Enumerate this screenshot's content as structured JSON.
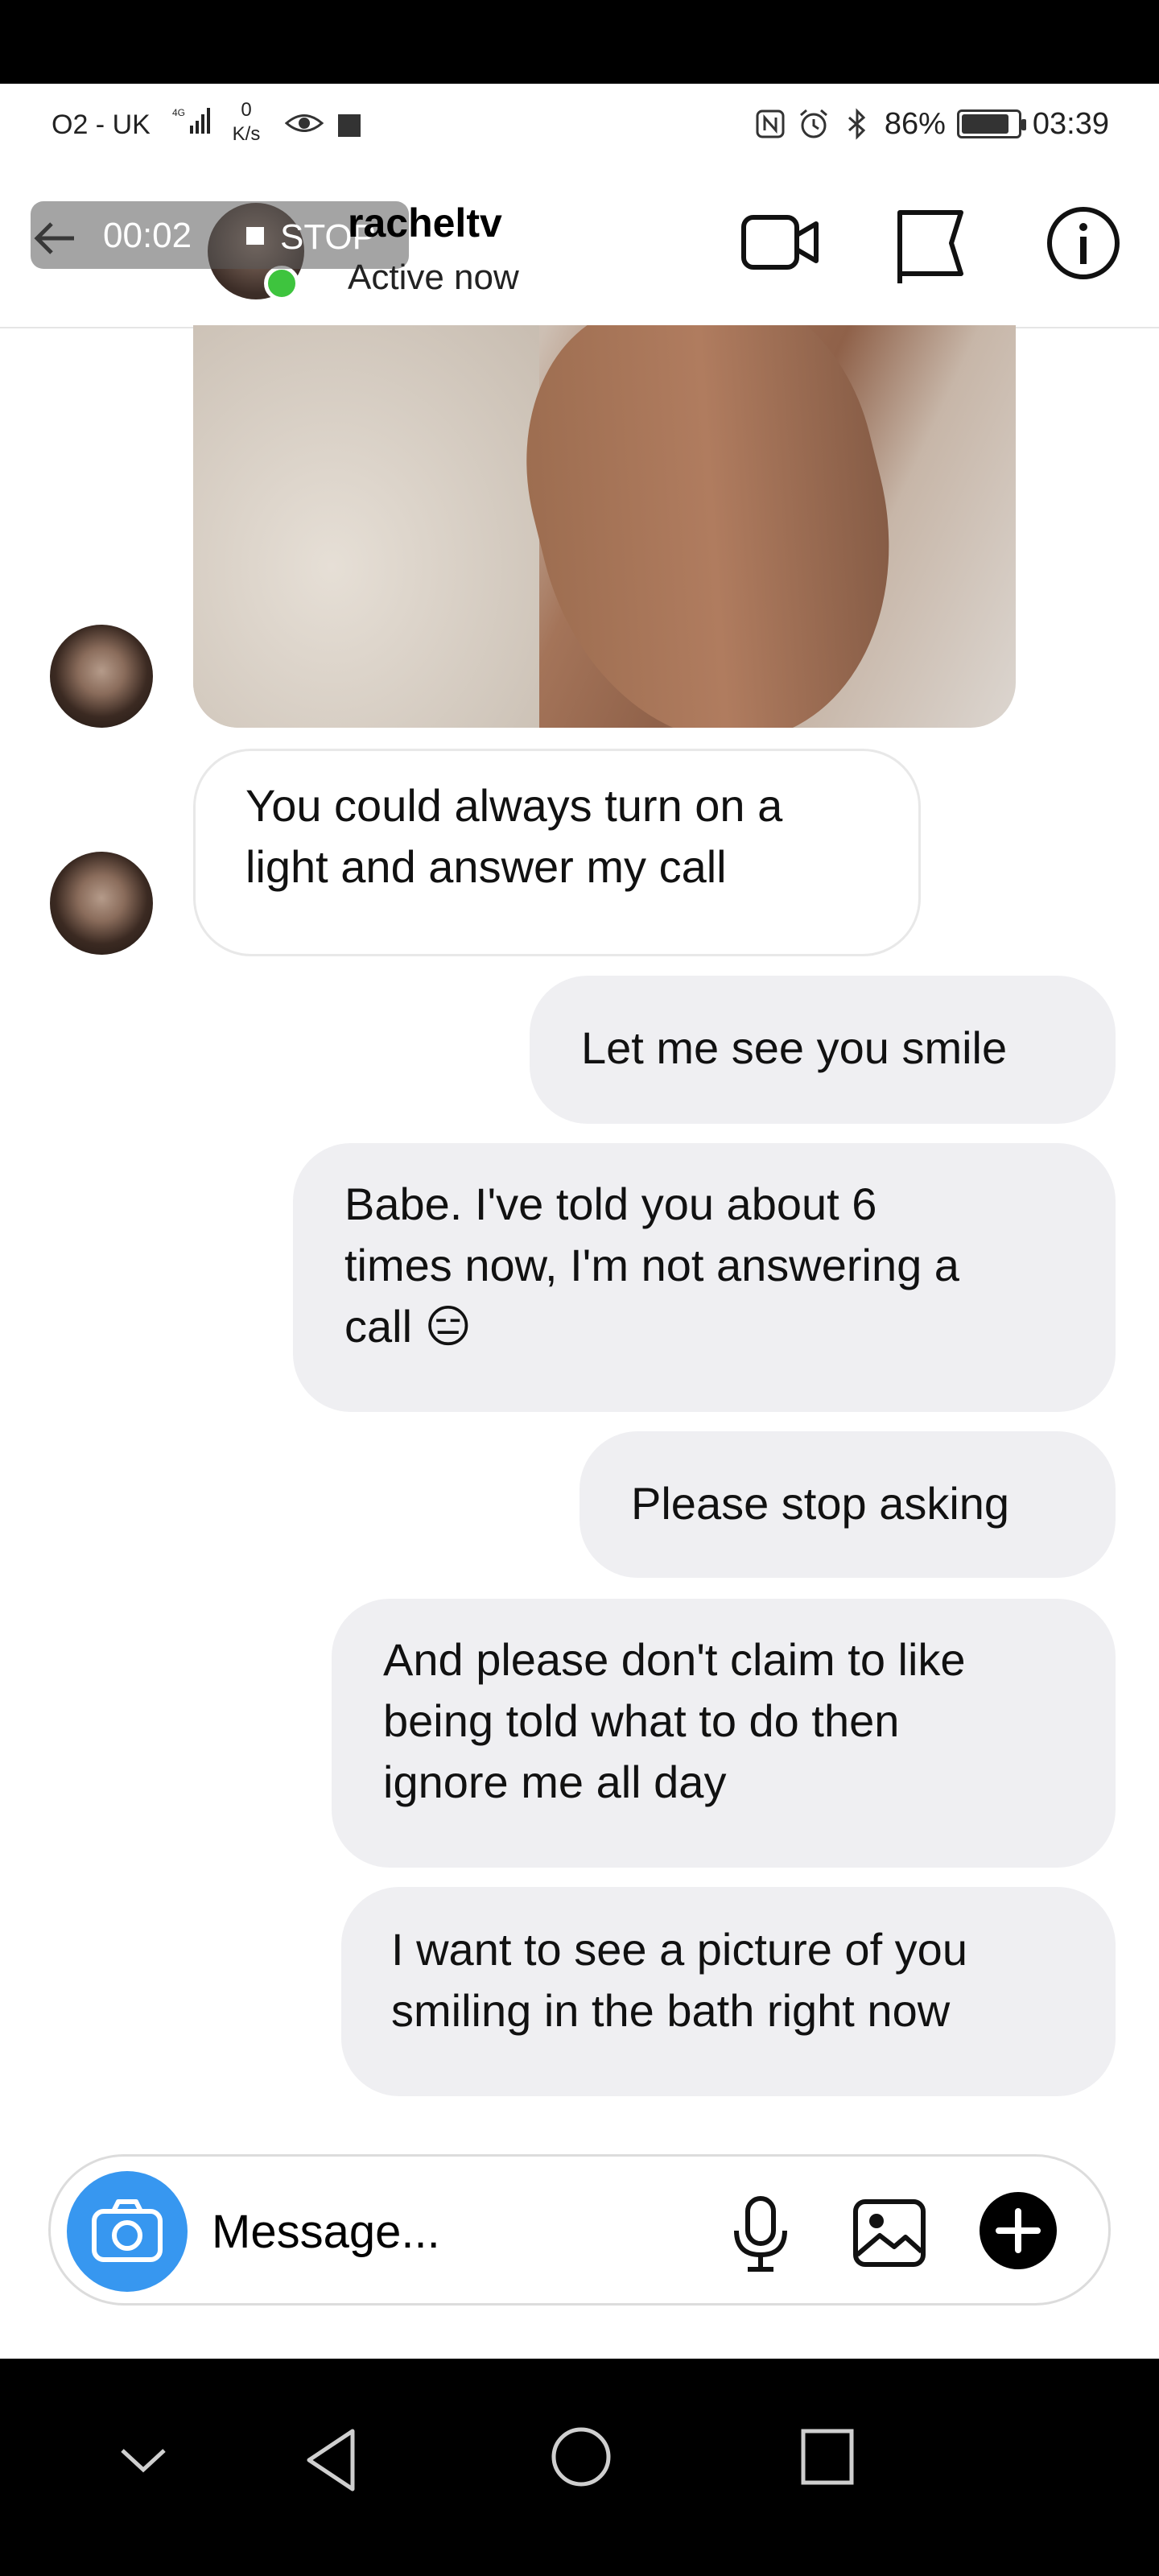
{
  "status_bar": {
    "carrier": "O2 - UK",
    "network": "4G",
    "speed_value": "0",
    "speed_unit": "K/s",
    "battery": "86%",
    "battery_level": 0.86,
    "time": "03:39"
  },
  "recording": {
    "time": "00:02",
    "stop_label": "STOP"
  },
  "header": {
    "username": "racheltv",
    "status": "Active now"
  },
  "messages": [
    {
      "from": "them",
      "lines": [
        "You could always turn on a",
        "light and answer my call"
      ]
    },
    {
      "from": "me",
      "lines": [
        "Let me see you smile"
      ]
    },
    {
      "from": "me",
      "lines": [
        "Babe. I've told you about 6",
        "times now, I'm not answering a",
        "call 😑"
      ]
    },
    {
      "from": "me",
      "lines": [
        "Please stop asking"
      ]
    },
    {
      "from": "me",
      "lines": [
        "And please don't claim to like",
        "being told what to do then",
        "ignore me all day"
      ]
    },
    {
      "from": "me",
      "lines": [
        "I want to see a picture of you",
        "smiling in the bath right now"
      ]
    }
  ],
  "composer": {
    "placeholder": "Message..."
  },
  "colors": {
    "accent": "#3797f0",
    "online": "#3ec43e",
    "bubble_out": "#efeff2"
  }
}
